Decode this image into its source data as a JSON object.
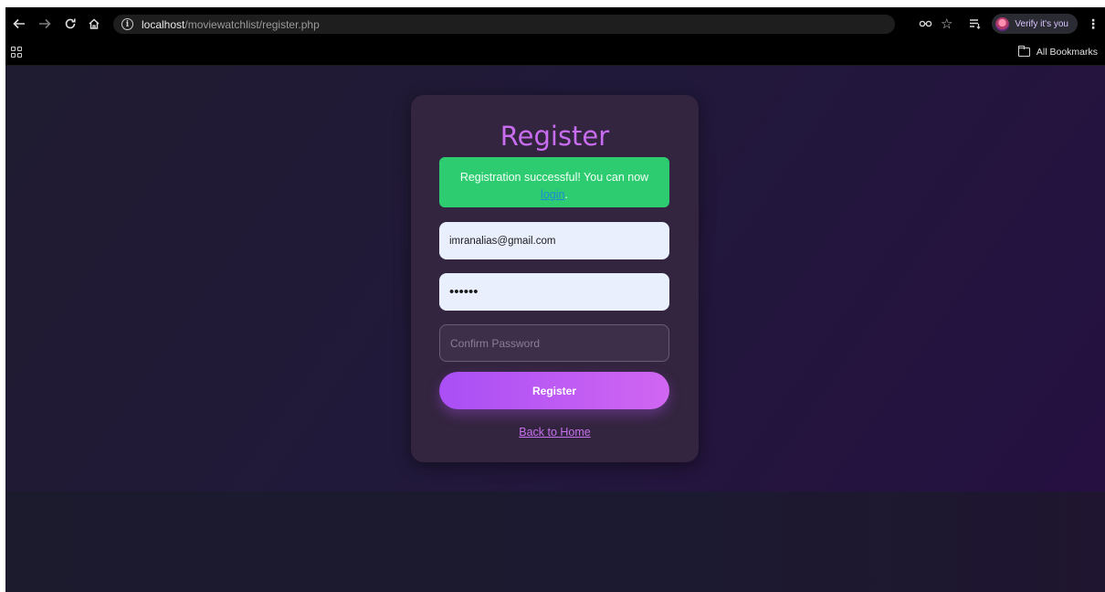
{
  "browser": {
    "url_host": "localhost",
    "url_path": "/moviewatchlist/register.php",
    "profile_label": "Verify it's you",
    "bookmarks_label": "All Bookmarks"
  },
  "page": {
    "title": "Register",
    "success_message": "Registration successful! You can now",
    "login_link": "login",
    "login_trailing": ".",
    "email_value": "imranalias@gmail.com",
    "password_mask": "••••••",
    "confirm_placeholder": "Confirm Password",
    "register_button": "Register",
    "back_link": "Back to Home"
  },
  "colors": {
    "accent": "#c86cf0",
    "success_bg": "#2ecc71",
    "card_bg": "#33243f",
    "button_start": "#a94ff5",
    "button_end": "#d166f2"
  }
}
